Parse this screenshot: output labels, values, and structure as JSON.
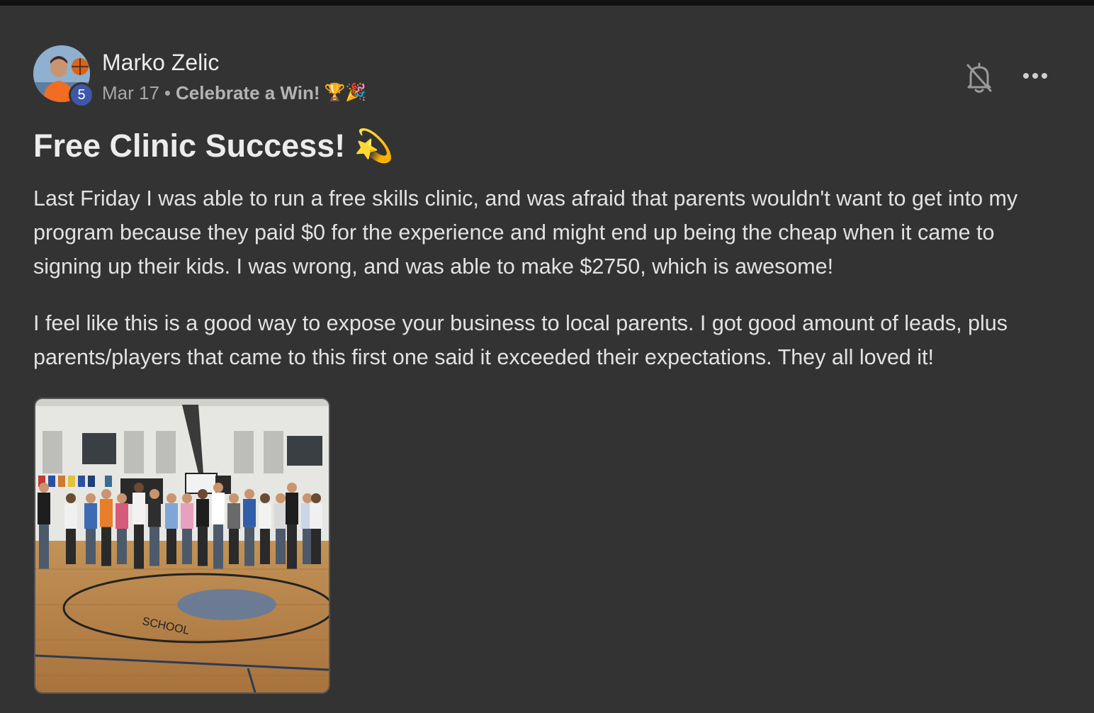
{
  "post": {
    "author": {
      "name": "Marko Zelic",
      "level": "5",
      "avatar_icon": "user-avatar"
    },
    "meta": {
      "date": "Mar 17",
      "separator": "•",
      "category": "Celebrate a Win!",
      "category_emoji": "🏆🎉"
    },
    "title": "Free Clinic Success! 💫",
    "body": [
      "Last Friday I was able to run a free skills clinic, and was afraid that parents wouldn't want to get into my program because they paid $0 for the experience and might end up being the cheap when it came to signing up their kids. I was wrong, and was able to make $2750, which is awesome!",
      "I feel like this is a good way to expose your business to local parents. I got good amount of leads, plus parents/players that came to this first one said it exceeded their expectations. They all loved it!"
    ],
    "actions": {
      "bell_icon": "bell-off-icon",
      "more_icon": "more-horizontal-icon"
    },
    "image": {
      "watermark": "SCHOOL"
    }
  },
  "colors": {
    "background": "#333333",
    "top_bar": "#121212",
    "text_primary": "#ececec",
    "text_secondary": "#a8a8a8",
    "level_badge": "#3e57a8"
  }
}
